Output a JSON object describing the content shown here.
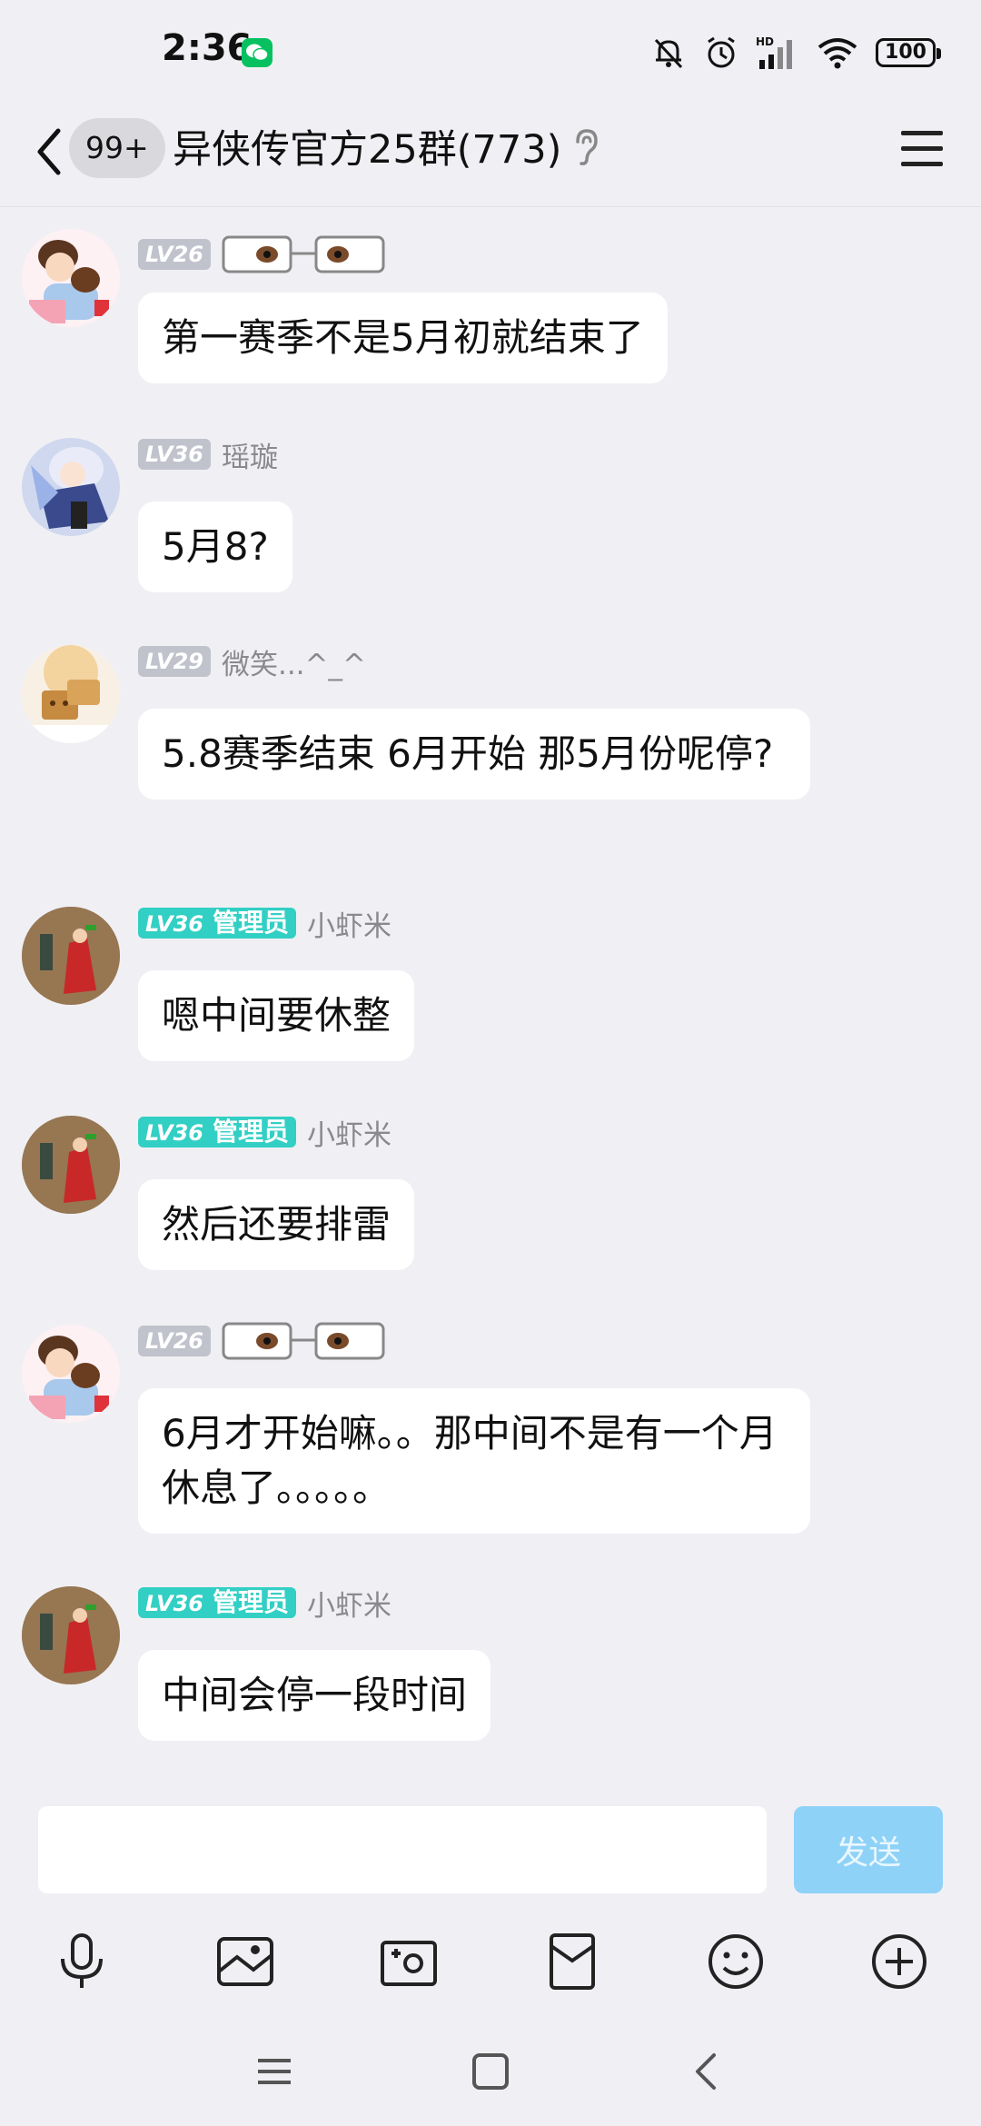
{
  "status": {
    "time": "2:36",
    "battery": "100",
    "network_label": "HD"
  },
  "header": {
    "unread_badge": "99+",
    "title": "异侠传官方25群(773)"
  },
  "messages": [
    {
      "level": "LV26",
      "role": "",
      "nick": "",
      "nick_decoration": "eyes-glasses",
      "text": "第一赛季不是5月初就结束了"
    },
    {
      "level": "LV36",
      "role": "",
      "nick": "瑶璇",
      "text": "5月8?"
    },
    {
      "level": "LV29",
      "role": "",
      "nick": "微笑...^_^",
      "text": "5.8赛季结束  6月开始  那5月份呢停?"
    },
    {
      "level": "LV36",
      "role": "管理员",
      "nick": "小虾米",
      "text": "嗯中间要休整"
    },
    {
      "level": "LV36",
      "role": "管理员",
      "nick": "小虾米",
      "text": "然后还要排雷"
    },
    {
      "level": "LV26",
      "role": "",
      "nick": "",
      "nick_decoration": "eyes-glasses",
      "text": "6月才开始嘛。。那中间不是有一个月休息了。。。。。"
    },
    {
      "level": "LV36",
      "role": "管理员",
      "nick": "小虾米",
      "text": "中间会停一段时间"
    }
  ],
  "input": {
    "value": "",
    "send_label": "发送"
  },
  "colors": {
    "background": "#f0f0f4",
    "bubble": "#ffffff",
    "admin_badge": "#32cfc4",
    "level_badge": "#c0c2cc",
    "send_button": "#8fd2f8"
  },
  "toolbar_icons": [
    "microphone-icon",
    "image-icon",
    "camera-icon",
    "red-packet-icon",
    "emoji-icon",
    "plus-icon"
  ],
  "nav_icons": [
    "menu-nav-icon",
    "home-nav-icon",
    "back-nav-icon"
  ]
}
